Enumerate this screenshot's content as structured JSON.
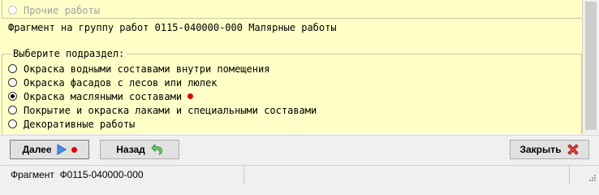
{
  "top_option": {
    "label": "Прочие работы",
    "disabled": true
  },
  "fragment_text": "Фрагмент на группу работ 0115-040000-000 Малярные работы",
  "group": {
    "legend": "Выберите подраздел:",
    "options": [
      {
        "label": "Окраска водными составами внутри помещения",
        "checked": false
      },
      {
        "label": "Окраска фасадов с лесов или люлек",
        "checked": false
      },
      {
        "label": "Окраска масляными составами",
        "checked": true,
        "marker": "red-dot"
      },
      {
        "label": "Покрытие и окраска лаками и специальными составами",
        "checked": false
      },
      {
        "label": "Декоративные работы",
        "checked": false
      }
    ]
  },
  "buttons": {
    "next_label": "Далее",
    "back_label": "Назад",
    "close_label": "Закрыть"
  },
  "icons": {
    "next": "play-arrow-icon",
    "back": "undo-arrow-icon",
    "close": "close-x-icon"
  },
  "status": {
    "text": "Фрагмент  Ф0115-040000-000"
  },
  "colors": {
    "panel_bg": "#ffffc8",
    "red_dot": "#e00000",
    "close_red": "#d42a2a",
    "arrow_blue": "#1e63c8",
    "back_green": "#2e9a3a"
  }
}
